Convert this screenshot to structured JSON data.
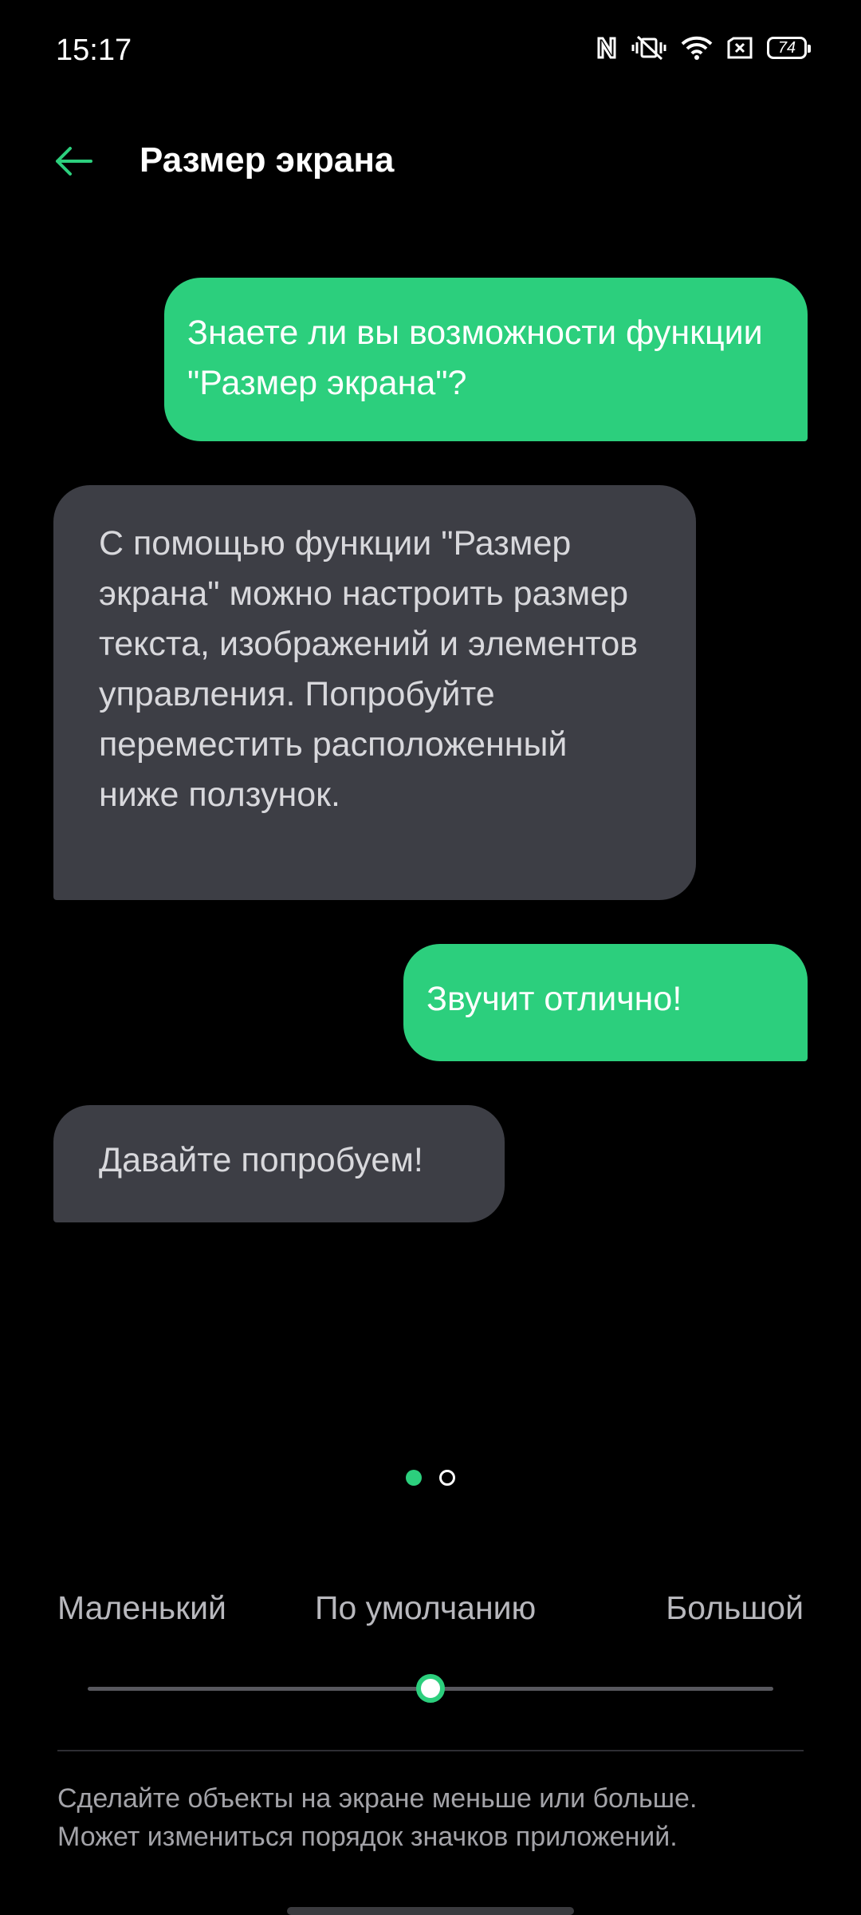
{
  "status_bar": {
    "time": "15:17",
    "icons": [
      "nfc-icon",
      "vibrate-icon",
      "wifi-icon",
      "no-sim-icon",
      "battery-icon"
    ],
    "battery_level": "74"
  },
  "header": {
    "title": "Размер экрана",
    "back_icon": "arrow-left-icon"
  },
  "conversation": [
    {
      "side": "right",
      "text": "Знаете ли вы возможности функции \"Размер экрана\"?"
    },
    {
      "side": "left",
      "text": "С помощью функции \"Размер экрана\" можно настроить размер текста, изображений и элементов управления. Попробуйте переместить расположенный ниже ползунок."
    },
    {
      "side": "right",
      "text": "Звучит отлично!"
    },
    {
      "side": "left",
      "text": "Давайте попробуем!"
    }
  ],
  "pager": {
    "total": 2,
    "active": 1
  },
  "size_slider": {
    "labels": {
      "small": "Маленький",
      "default": "По умолчанию",
      "large": "Большой"
    },
    "value_fraction": 0.5
  },
  "description": {
    "line1": "Сделайте объекты на экране меньше или больше.",
    "line2": "Может измениться порядок значков приложений."
  },
  "colors": {
    "accent": "#2ccf7d",
    "bubble_gray": "#3d3e45",
    "background": "#000000"
  }
}
